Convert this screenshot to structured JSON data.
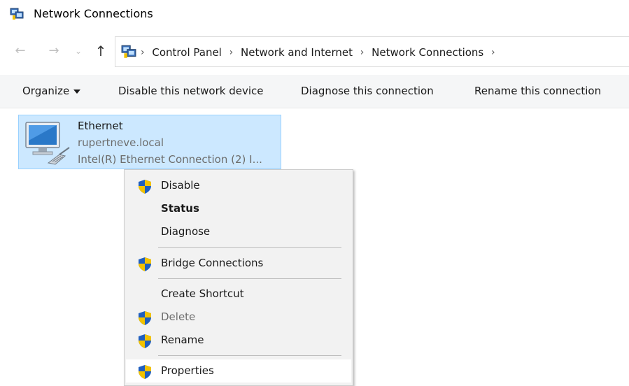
{
  "window": {
    "title": "Network Connections"
  },
  "addressbar": {
    "breadcrumbs": [
      "Control Panel",
      "Network and Internet",
      "Network Connections"
    ]
  },
  "commandbar": {
    "organize": "Organize",
    "disable_device": "Disable this network device",
    "diagnose": "Diagnose this connection",
    "rename": "Rename this connection"
  },
  "connection": {
    "name": "Ethernet",
    "domain": "rupertneve.local",
    "adapter": "Intel(R) Ethernet Connection (2) I..."
  },
  "context_menu": {
    "items": [
      {
        "label": "Disable",
        "icon": "shield-icon",
        "bold": false,
        "enabled": true
      },
      {
        "label": "Status",
        "icon": "",
        "bold": true,
        "enabled": true
      },
      {
        "label": "Diagnose",
        "icon": "",
        "bold": false,
        "enabled": true
      },
      {
        "label": "Bridge Connections",
        "icon": "shield-icon",
        "bold": false,
        "enabled": true
      },
      {
        "label": "Create Shortcut",
        "icon": "",
        "bold": false,
        "enabled": true
      },
      {
        "label": "Delete",
        "icon": "shield-icon",
        "bold": false,
        "enabled": false
      },
      {
        "label": "Rename",
        "icon": "shield-icon",
        "bold": false,
        "enabled": true
      },
      {
        "label": "Properties",
        "icon": "shield-icon",
        "bold": false,
        "enabled": true
      }
    ]
  },
  "colors": {
    "selection_fill": "#cce8ff",
    "selection_border": "#99d1ff",
    "menu_background": "#f2f2f2",
    "shield_blue": "#1f5fbf",
    "shield_yellow": "#f2c200"
  }
}
